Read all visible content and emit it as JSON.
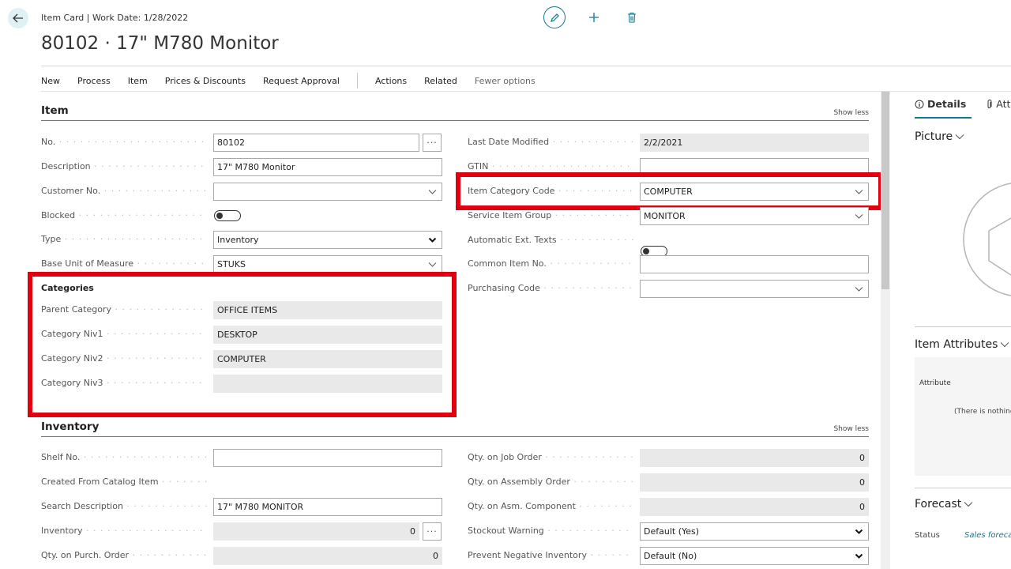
{
  "header": {
    "breadcrumb": "Item Card | Work Date: 1/28/2022",
    "title": "80102 · 17\" M780 Monitor"
  },
  "actionbar": {
    "items": [
      "New",
      "Process",
      "Item",
      "Prices & Discounts",
      "Request Approval"
    ],
    "actions": "Actions",
    "related": "Related",
    "fewer": "Fewer options"
  },
  "item_section": {
    "title": "Item",
    "show_less": "Show less",
    "no_label": "No.",
    "no_value": "80102",
    "description_label": "Description",
    "description_value": "17\" M780 Monitor",
    "customer_no_label": "Customer No.",
    "customer_no_value": "",
    "blocked_label": "Blocked",
    "type_label": "Type",
    "type_value": "Inventory",
    "base_uom_label": "Base Unit of Measure",
    "base_uom_value": "STUKS",
    "last_modified_label": "Last Date Modified",
    "last_modified_value": "2/2/2021",
    "gtin_label": "GTIN",
    "gtin_value": "",
    "category_code_label": "Item Category Code",
    "category_code_value": "COMPUTER",
    "service_group_label": "Service Item Group",
    "service_group_value": "MONITOR",
    "auto_ext_label": "Automatic Ext. Texts",
    "common_item_label": "Common Item No.",
    "common_item_value": "",
    "purchasing_code_label": "Purchasing Code",
    "purchasing_code_value": ""
  },
  "categories": {
    "title": "Categories",
    "parent_label": "Parent Category",
    "parent_value": "OFFICE ITEMS",
    "niv1_label": "Category Niv1",
    "niv1_value": "DESKTOP",
    "niv2_label": "Category Niv2",
    "niv2_value": "COMPUTER",
    "niv3_label": "Category Niv3",
    "niv3_value": ""
  },
  "inventory_section": {
    "title": "Inventory",
    "show_less": "Show less",
    "shelf_label": "Shelf No.",
    "shelf_value": "",
    "catalog_label": "Created From Catalog Item",
    "search_desc_label": "Search Description",
    "search_desc_value": "17\" M780 MONITOR",
    "inventory_label": "Inventory",
    "inventory_value": "0",
    "purch_order_label": "Qty. on Purch. Order",
    "purch_order_value": "0",
    "job_order_label": "Qty. on Job Order",
    "job_order_value": "0",
    "assembly_order_label": "Qty. on Assembly Order",
    "assembly_order_value": "0",
    "asm_component_label": "Qty. on Asm. Component",
    "asm_component_value": "0",
    "stockout_label": "Stockout Warning",
    "stockout_value": "Default (Yes)",
    "prevent_neg_label": "Prevent Negative Inventory",
    "prevent_neg_value": "Default (No)"
  },
  "factbox": {
    "details_tab": "Details",
    "attachments_tab": "Atta",
    "picture_title": "Picture",
    "attributes_title": "Item Attributes",
    "attribute_header": "Attribute",
    "attributes_empty": "(There is nothing",
    "forecast_title": "Forecast",
    "status_label": "Status",
    "status_value": "Sales foreca"
  },
  "colors": {
    "accent": "#0f7a8a",
    "highlight": "#e1000f"
  }
}
